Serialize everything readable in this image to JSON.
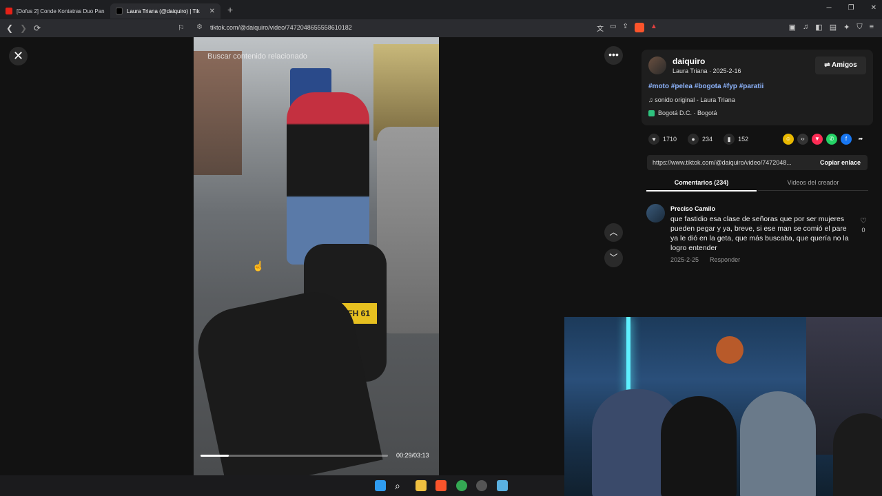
{
  "browser": {
    "tabs": [
      {
        "title": "[Dofus 2] Conde Kontatras Duo Pand",
        "close": "✕"
      },
      {
        "title": "Laura Triana (@daiquiro) | Tik",
        "close": "✕"
      }
    ],
    "new_tab": "+",
    "url": "tiktok.com/@daiquiro/video/7472048655558610182"
  },
  "video": {
    "search_placeholder": "Buscar contenido relacionado",
    "time": "00:29/03:13",
    "progress": 0.15,
    "plate": "IFH 61"
  },
  "post": {
    "username": "daiquiro",
    "subline": "Laura Triana · 2025-2-16",
    "friends_button": "⇌ Amigos",
    "hashtags": "#moto #pelea #bogota #fyp #paratii",
    "sound": "♫ sonido original - Laura Triana",
    "location": "Bogotá D.C. · Bogotá",
    "likes": "1710",
    "comments": "234",
    "saves": "152",
    "link": "https://www.tiktok.com/@daiquiro/video/7472048...",
    "copy_link": "Copiar enlace"
  },
  "tabs": {
    "comments": "Comentarios (234)",
    "creator_videos": "Videos del creador"
  },
  "comment": {
    "author": "Preciso Camilo",
    "text": "que fastidio esa clase de señoras que por ser mujeres pueden pegar y ya, breve, si ese man se comió el pare ya le dió en la geta, que más buscaba, que quería no la logro entender",
    "date": "2025-2-25",
    "reply": "Responder",
    "likes": "0"
  },
  "colors": {
    "accent_link": "#8fb6ff",
    "page_bg": "#121212"
  }
}
